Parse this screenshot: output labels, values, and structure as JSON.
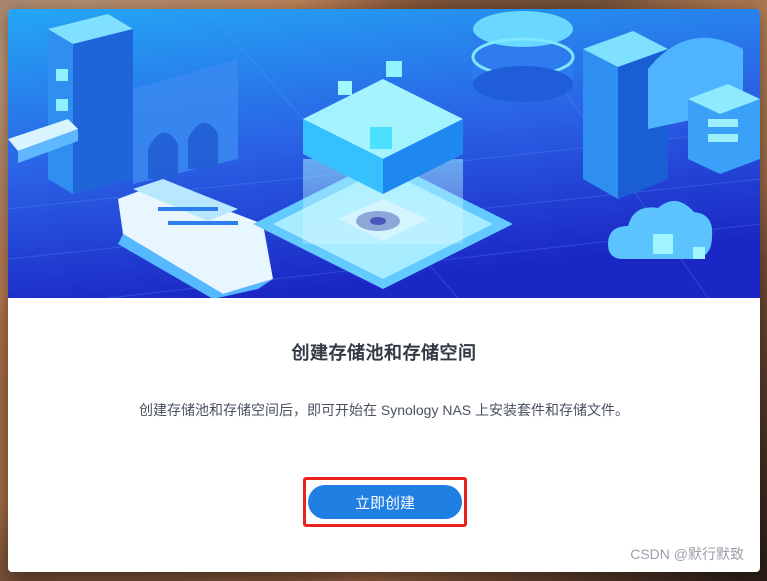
{
  "dialog": {
    "title": "创建存储池和存储空间",
    "description": "创建存储池和存储空间后，即可开始在 Synology NAS 上安装套件和存储文件。",
    "create_button_label": "立即创建"
  },
  "watermark": {
    "text": "CSDN @默行默致"
  },
  "colors": {
    "accent": "#1f7fe2",
    "hero_top": "#1e9af0",
    "hero_bottom": "#1a2fc8",
    "highlight": "#e8231d"
  }
}
